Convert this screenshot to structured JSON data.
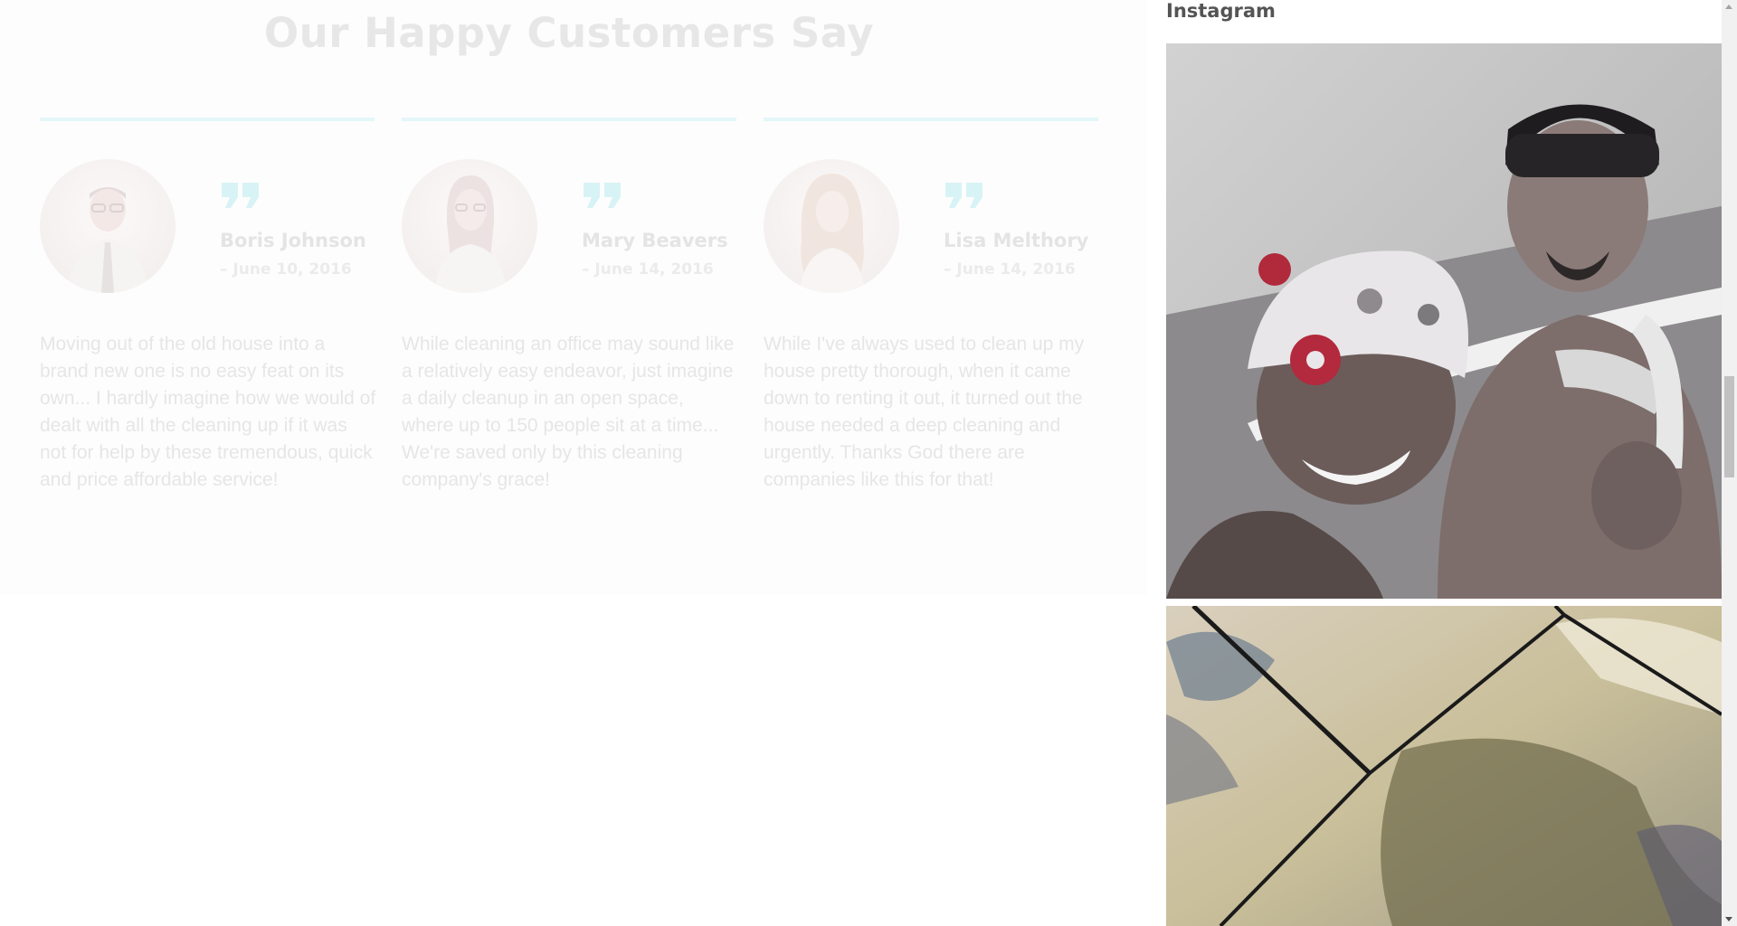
{
  "testimonials": {
    "title": "Our Happy Customers Say",
    "items": [
      {
        "name": "Boris Johnson",
        "date": "– June 10, 2016",
        "text": "Moving out of the old house into a brand new one is no easy feat on its own... I hardly imagine how we would of dealt with all the cleaning up if it was not for help by these tremendous, quick and price affordable service!",
        "avatar_icon": "man-with-glasses-avatar"
      },
      {
        "name": "Mary Beavers",
        "date": "– June 14, 2016",
        "text": "While cleaning an office may sound like a relatively easy endeavor, just imagine a daily cleanup in an open space, where up to 150 people sit at a time... We're saved only by this cleaning company's grace!",
        "avatar_icon": "woman-with-glasses-avatar"
      },
      {
        "name": "Lisa Melthory",
        "date": "– June 14, 2016",
        "text": "While I've always used to clean up my house pretty thorough, when it came down to renting it out, it turned out the house needed a deep cleaning and urgently. Thanks God there are companies like this for that!",
        "avatar_icon": "woman-long-hair-avatar"
      }
    ],
    "accent_color": "#e4f6f8"
  },
  "instagram": {
    "title": "Instagram",
    "photos": [
      {
        "icon": "bathtub-photo"
      },
      {
        "icon": "tile-floor-photo"
      }
    ]
  },
  "scrollbar": {
    "up_icon": "scroll-up-arrow-icon",
    "down_icon": "scroll-down-arrow-icon"
  }
}
